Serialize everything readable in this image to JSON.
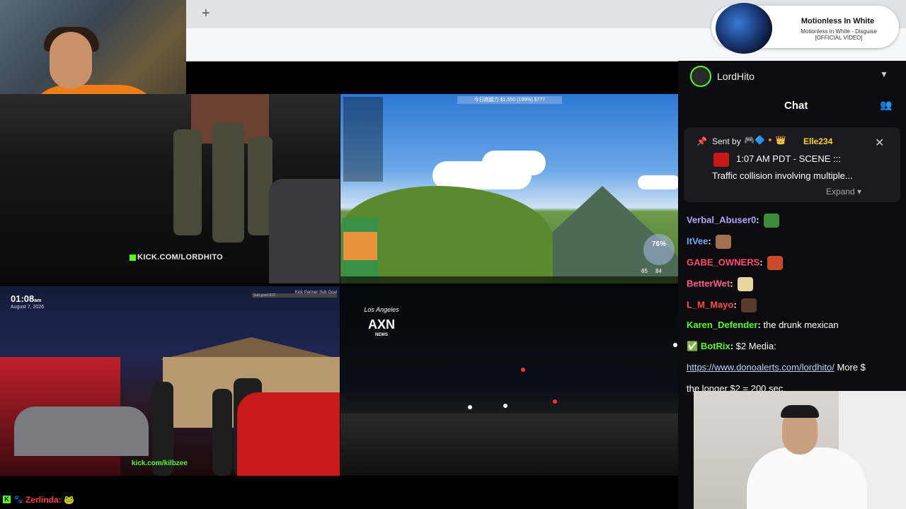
{
  "browser": {
    "new_tab_label": "+"
  },
  "music": {
    "artist": "Motionless In White",
    "track": "Motionless In White - Disguise [OFFICIAL VIDEO]"
  },
  "panels": {
    "topleft": {
      "kick_url": "KICK.COM/LORDHITO"
    },
    "topright": {
      "top_text": "今日跑腿力  $1,550 (199%)  $777",
      "percent": "76%",
      "stat_a": "85",
      "stat_b": "84"
    },
    "bottomleft": {
      "time": "01:08",
      "ampm": "am",
      "date": "August 7, 2026",
      "subgoal_title": "Kick Partner Sub Goal",
      "subgoal_bar": "Sub goal 0/22",
      "kick_url": "kick.com/kilbzee"
    },
    "bottomright": {
      "logo_top": "Los Angeles",
      "logo_main": "AXN",
      "logo_sub": "NEWS"
    }
  },
  "sidebar": {
    "channel_name": "LordHito",
    "chat_title": "Chat",
    "pinned": {
      "sent_by": "Sent by",
      "author": "Elle234",
      "line1": "1:07 AM PDT - SCENE :::",
      "line2": "Traffic collision involving multiple...",
      "expand": "Expand"
    },
    "messages": [
      {
        "user": "Verbal_Abuser0",
        "color": "#b8a4ff",
        "text": ""
      },
      {
        "user": "ItVee",
        "color": "#6aa8ff",
        "text": ""
      },
      {
        "user": "GABE_OWNERS",
        "color": "#ff4a6a",
        "text": ""
      },
      {
        "user": "BetterWet",
        "color": "#ff5a8a",
        "text": ""
      },
      {
        "user": "L_M_Mayo",
        "color": "#ff4a4a",
        "text": ""
      },
      {
        "user": "Karen_Defender",
        "color": "#53fc18",
        "text": "the drunk mexican"
      },
      {
        "user": "BotRix",
        "color": "#53fc18",
        "text": "$2 Media:"
      },
      {
        "user": "",
        "color": "#fff",
        "text": "More $"
      },
      {
        "user": "",
        "color": "#fff",
        "text": "the longer $2 = 200 sec"
      }
    ],
    "link": "https://www.donoalerts.com/lordhito/"
  },
  "bottom_chat": {
    "user": "Zerlinda",
    "kick_badge": "K"
  },
  "colors": {
    "kick_green": "#53fc18",
    "bg": "#000000",
    "panel": "#0c0c0e"
  }
}
